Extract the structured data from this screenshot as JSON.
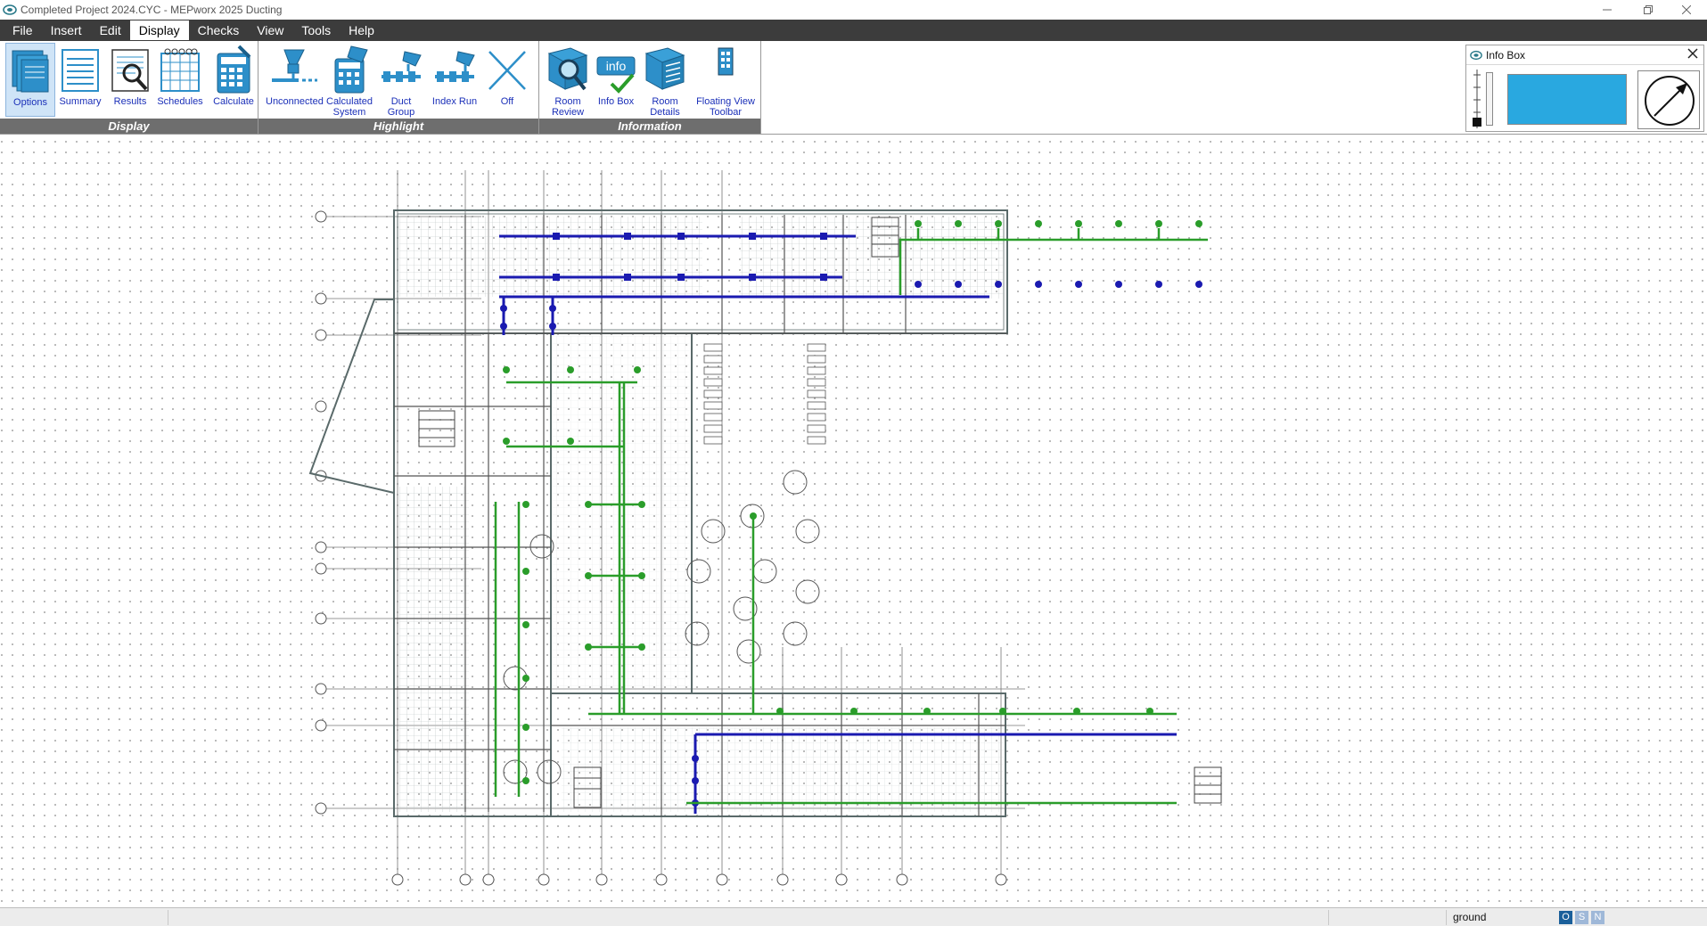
{
  "window": {
    "title": "Completed Project 2024.CYC - MEPworx 2025 Ducting",
    "controls": [
      "minimize",
      "restore",
      "close"
    ]
  },
  "menu": {
    "items": [
      {
        "label": "File"
      },
      {
        "label": "Insert"
      },
      {
        "label": "Edit"
      },
      {
        "label": "Display",
        "active": true
      },
      {
        "label": "Checks"
      },
      {
        "label": "View"
      },
      {
        "label": "Tools"
      },
      {
        "label": "Help"
      }
    ]
  },
  "ribbon": {
    "groups": [
      {
        "label": "Display",
        "buttons": [
          {
            "label": "Options",
            "icon": "options-icon",
            "active": true
          },
          {
            "label": "Summary",
            "icon": "summary-icon"
          },
          {
            "label": "Results",
            "icon": "results-icon"
          },
          {
            "label": "Schedules",
            "icon": "schedules-icon"
          },
          {
            "label": "Calculate",
            "icon": "calculate-icon"
          }
        ]
      },
      {
        "label": "Highlight",
        "buttons": [
          {
            "label": "Unconnected",
            "icon": "unconnected-icon"
          },
          {
            "label": "Calculated System",
            "icon": "calculated-system-icon"
          },
          {
            "label": "Duct Group",
            "icon": "duct-group-icon"
          },
          {
            "label": "Index Run",
            "icon": "index-run-icon"
          },
          {
            "label": "Off",
            "icon": "off-x-icon"
          }
        ]
      },
      {
        "label": "Information",
        "buttons": [
          {
            "label": "Room Review",
            "icon": "room-review-icon"
          },
          {
            "label": "Info Box",
            "icon": "info-box-icon",
            "icon_text": "info"
          },
          {
            "label": "Room Details",
            "icon": "room-details-icon"
          },
          {
            "label": "Floating View Toolbar",
            "icon": "floating-toolbar-icon"
          }
        ]
      }
    ]
  },
  "info_box": {
    "title": "Info Box",
    "colors": {
      "swatch": "#29a8e0"
    },
    "icons": [
      "info-box-icon",
      "close-icon",
      "level-scale-icon",
      "color-swatch",
      "north-arrow-icon"
    ]
  },
  "status_bar": {
    "layer": "ground",
    "toggles": [
      {
        "label": "O",
        "active": true
      },
      {
        "label": "S"
      },
      {
        "label": "N"
      }
    ]
  },
  "colors": {
    "menubar": "#3c3c3c",
    "ribbon_label_bg": "#6e6e6e",
    "ribbon_text": "#1a2fb8",
    "icon_blue": "#2d8fc9",
    "duct_supply": "#2a9d2a",
    "duct_extract": "#1a1ab0",
    "wall": "#5a6a6a"
  }
}
